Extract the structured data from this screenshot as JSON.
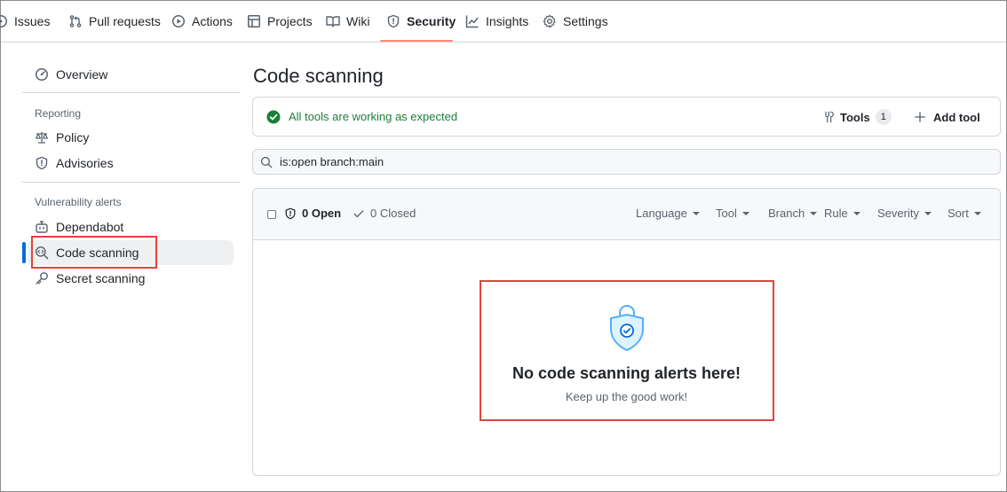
{
  "nav": {
    "tabs": [
      {
        "label": "Issues",
        "icon": "issue-icon"
      },
      {
        "label": "Pull requests",
        "icon": "pull-request-icon"
      },
      {
        "label": "Actions",
        "icon": "play-icon"
      },
      {
        "label": "Projects",
        "icon": "table-icon"
      },
      {
        "label": "Wiki",
        "icon": "book-icon"
      },
      {
        "label": "Security",
        "icon": "shield-icon",
        "selected": true
      },
      {
        "label": "Insights",
        "icon": "graph-icon"
      },
      {
        "label": "Settings",
        "icon": "gear-icon"
      }
    ]
  },
  "sidebar": {
    "overview": "Overview",
    "reporting_heading": "Reporting",
    "policy": "Policy",
    "advisories": "Advisories",
    "vuln_heading": "Vulnerability alerts",
    "dependabot": "Dependabot",
    "code_scanning": "Code scanning",
    "secret_scanning": "Secret scanning"
  },
  "main": {
    "title": "Code scanning",
    "status": "All tools are working as expected",
    "tools_label": "Tools",
    "tools_count": "1",
    "add_tool_label": "Add tool",
    "search_value": "is:open branch:main",
    "open_label": "0 Open",
    "closed_label": "0 Closed",
    "filters": {
      "language": "Language",
      "tool": "Tool",
      "branch": "Branch",
      "rule": "Rule",
      "severity": "Severity",
      "sort": "Sort"
    },
    "empty_title": "No code scanning alerts here!",
    "empty_subtitle": "Keep up the good work!"
  },
  "colors": {
    "accent": "#0969da",
    "success": "#1a7f37",
    "selected_underline": "#fd8c73",
    "highlight_box": "#e0443e"
  }
}
